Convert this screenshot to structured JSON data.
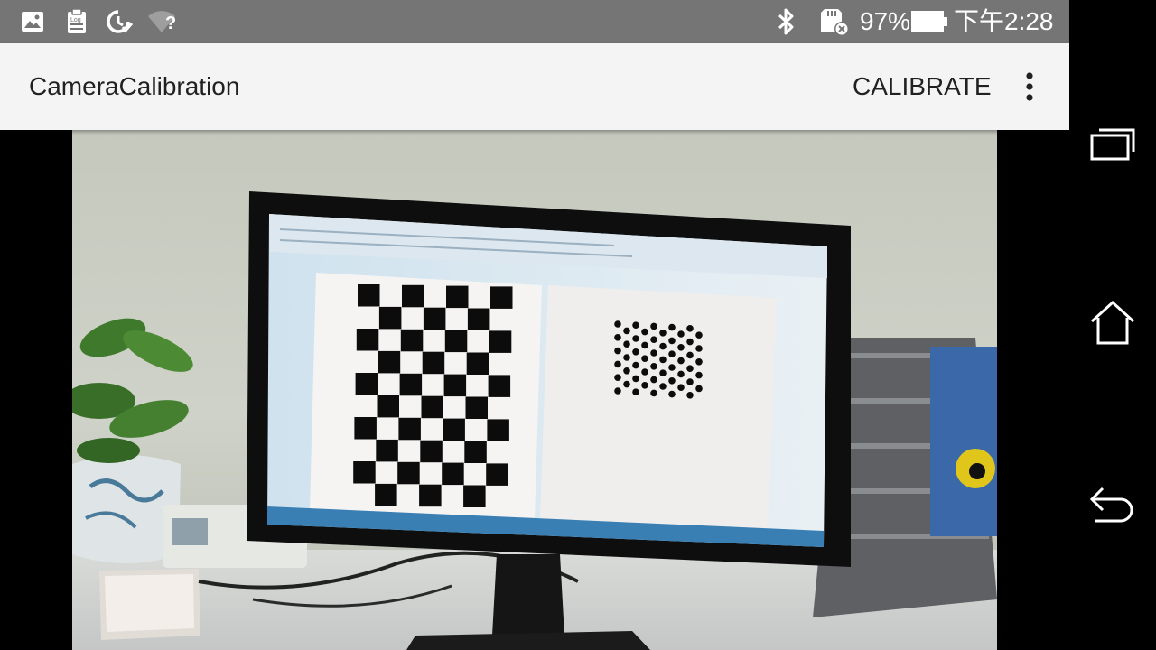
{
  "status_bar": {
    "icons_left": [
      "image-icon",
      "log-clipboard-icon",
      "sync-check-icon",
      "wifi-question-icon"
    ],
    "log_label": "Log",
    "wifi_label": "?",
    "icons_right": [
      "bluetooth-icon",
      "sd-card-icon",
      "battery-icon"
    ],
    "battery": "97%",
    "time": "下午2:28"
  },
  "app_bar": {
    "title": "CameraCalibration",
    "calibrate_label": "CALIBRATE",
    "overflow_icon": "more-vert-icon"
  },
  "camera_preview": {
    "scene": "camera-feed",
    "left_pattern": "checkerboard",
    "right_pattern": "asymmetric-circles-grid"
  },
  "nav_bar": {
    "icons": [
      "recent-apps-icon",
      "home-icon",
      "back-icon"
    ]
  },
  "colors": {
    "status_bar": "#757575",
    "app_bar": "#f4f4f4",
    "text": "#212121",
    "nav_bar": "#000000"
  }
}
